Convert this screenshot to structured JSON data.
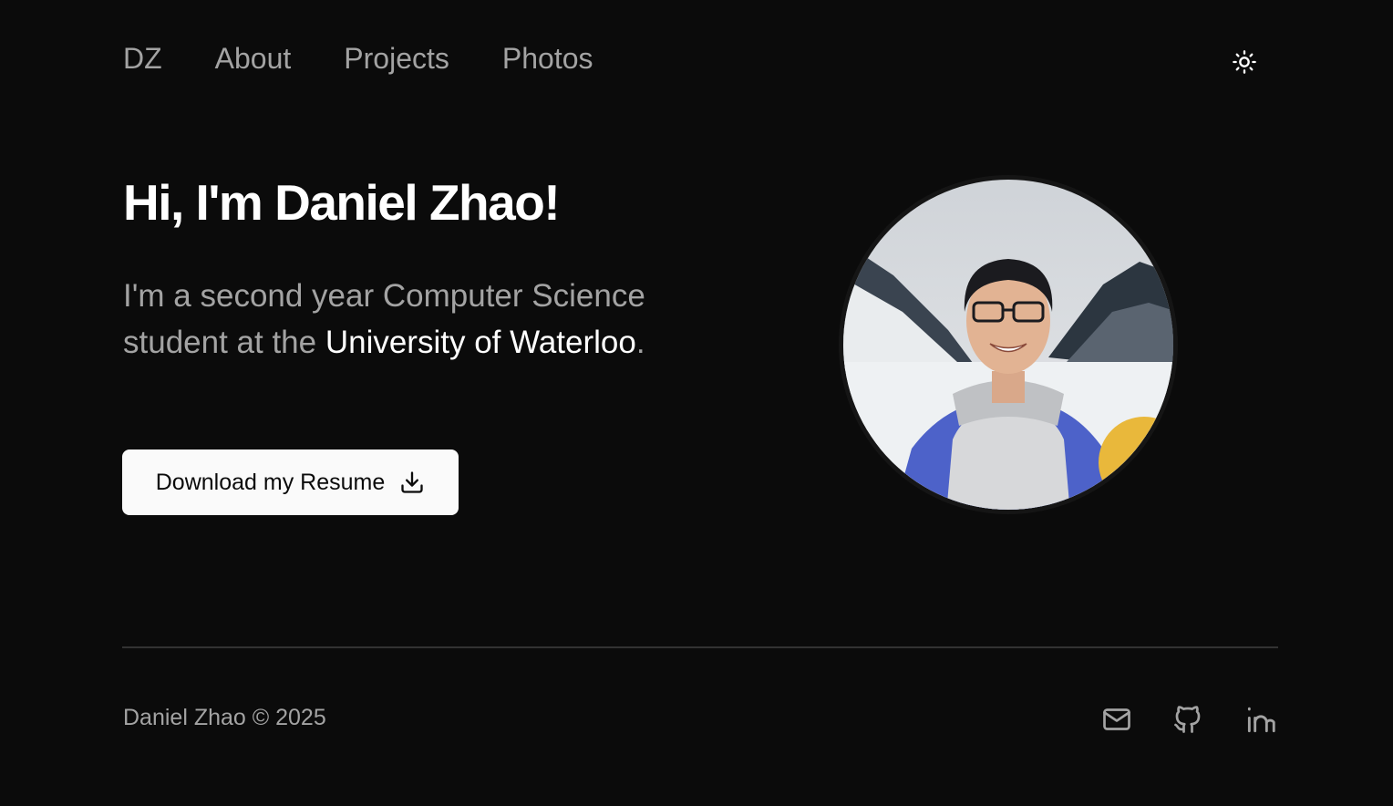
{
  "nav": {
    "logo": "DZ",
    "items": [
      {
        "label": "About"
      },
      {
        "label": "Projects"
      },
      {
        "label": "Photos"
      }
    ],
    "theme_toggle_icon": "sun-icon"
  },
  "hero": {
    "title": "Hi, I'm Daniel Zhao!",
    "desc_part1": "I'm a second year Computer Science student at the ",
    "desc_highlight": "University of Waterloo",
    "desc_end": ".",
    "button_label": "Download my Resume",
    "button_icon": "download-icon",
    "avatar_icon": "avatar"
  },
  "footer": {
    "copyright": "Daniel Zhao © 2025",
    "social_icons": [
      "mail-icon",
      "github-icon",
      "linkedin-icon"
    ]
  },
  "colors": {
    "background": "#0b0b0b",
    "text_primary": "#ffffff",
    "text_muted": "#a3a3a3",
    "button_bg": "#fafafa",
    "divider": "#333333"
  }
}
